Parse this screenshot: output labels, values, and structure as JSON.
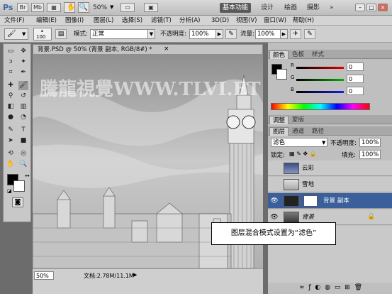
{
  "app": {
    "logo": "Ps",
    "icons": [
      "Br",
      "Mb"
    ],
    "zoom_top": "50%",
    "workspaces": [
      "基本功能",
      "设计",
      "绘画",
      "摄影"
    ],
    "window_buttons": [
      "–",
      "□",
      "×"
    ]
  },
  "menu": [
    "文件(F)",
    "编辑(E)",
    "图像(I)",
    "图层(L)",
    "选择(S)",
    "滤镜(T)",
    "分析(A)",
    "3D(D)",
    "视图(V)",
    "窗口(W)",
    "帮助(H)"
  ],
  "options": {
    "brush_size": "100",
    "mode_label": "模式:",
    "mode_value": "正常",
    "opacity_label": "不透明度:",
    "opacity_value": "100%",
    "flow_label": "流量:",
    "flow_value": "100%"
  },
  "document": {
    "tab_title": "背景.PSD @ 50% (背景 副本, RGB/8#) *",
    "watermark": "騰龍視覺WWW.TLVI.ET",
    "zoom": "50%",
    "doc_info": "文档:2.78M/11.1M"
  },
  "color_panel": {
    "tabs": [
      "颜色",
      "色板",
      "样式"
    ],
    "channels": [
      {
        "label": "R",
        "value": "0"
      },
      {
        "label": "G",
        "value": "0"
      },
      {
        "label": "B",
        "value": "0"
      }
    ]
  },
  "adjust_tabs": [
    "调整",
    "蒙版"
  ],
  "layers_panel": {
    "tabs": [
      "图层",
      "通道",
      "路径"
    ],
    "blend_mode": "滤色",
    "opacity_label": "不透明度:",
    "opacity_value": "100%",
    "lock_label": "锁定:",
    "fill_label": "填充:",
    "fill_value": "100%",
    "layers": [
      {
        "name": "云彩",
        "visible": false,
        "selected": false
      },
      {
        "name": "雪地",
        "visible": false,
        "selected": false
      },
      {
        "name": "背景 副本",
        "visible": true,
        "selected": true
      },
      {
        "name": "背景",
        "visible": true,
        "selected": false
      }
    ]
  },
  "callout": "图层混合模式设置为“滤色”"
}
